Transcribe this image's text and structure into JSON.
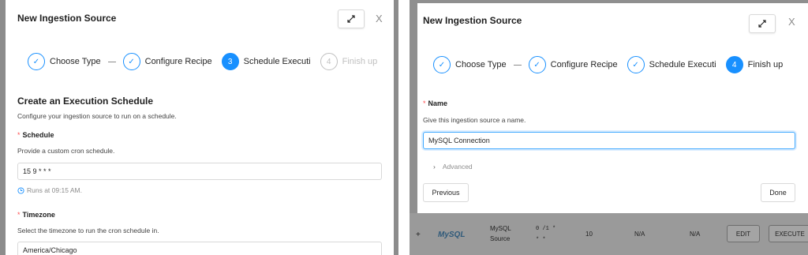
{
  "left_panel": {
    "modal_title": "New Ingestion Source",
    "close_symbol": "X",
    "steps": [
      {
        "label": "Choose Type",
        "state": "done",
        "marker": "✓"
      },
      {
        "label": "Configure Recipe",
        "state": "done",
        "marker": "✓"
      },
      {
        "label": "Schedule Executi",
        "state": "active",
        "marker": "3"
      },
      {
        "label": "Finish up",
        "state": "todo",
        "marker": "4"
      }
    ],
    "section_title": "Create an Execution Schedule",
    "section_desc": "Configure your ingestion source to run on a schedule.",
    "schedule_label": "Schedule",
    "schedule_desc": "Provide a custom cron schedule.",
    "schedule_value": "15 9 * * *",
    "schedule_hint": "Runs at 09:15 AM.",
    "timezone_label": "Timezone",
    "timezone_desc": "Select the timezone to run the cron schedule in.",
    "timezone_value": "America/Chicago"
  },
  "right_panel": {
    "modal_title": "New Ingestion Source",
    "close_symbol": "X",
    "steps": [
      {
        "label": "Choose Type",
        "state": "done",
        "marker": "✓"
      },
      {
        "label": "Configure Recipe",
        "state": "done",
        "marker": "✓"
      },
      {
        "label": "Schedule Executi",
        "state": "done",
        "marker": "✓"
      },
      {
        "label": "Finish up",
        "state": "active",
        "marker": "4"
      }
    ],
    "name_label": "Name",
    "name_desc": "Give this ingestion source a name.",
    "name_value": "MySQL Connection",
    "advanced_label": "Advanced",
    "previous_button": "Previous",
    "done_button": "Done",
    "table_row": {
      "plus": "+",
      "logo_text": "MySQL",
      "type_line1": "MySQL",
      "type_line2": "Source",
      "schedule_line1": "0 /1 *",
      "schedule_line2": "* *",
      "count": "10",
      "col_na1": "N/A",
      "col_na2": "N/A",
      "edit_button": "EDIT",
      "execute_button": "EXECUTE"
    }
  },
  "colors": {
    "accent": "#1890ff",
    "required": "#ff4d4f",
    "overlay": "#8c8c8c"
  }
}
